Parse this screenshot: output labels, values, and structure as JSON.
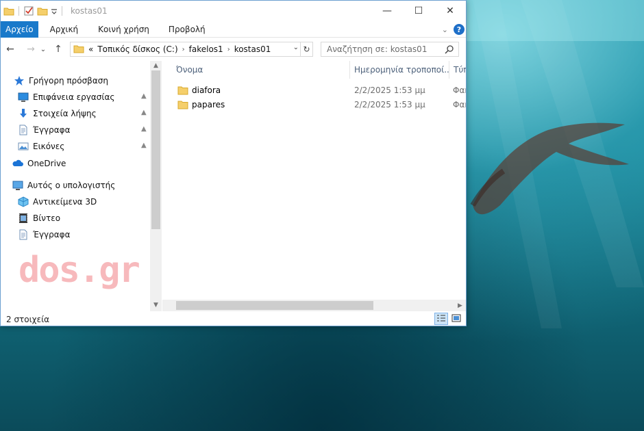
{
  "window": {
    "title": "kostas01",
    "controls": {
      "minimize": "—",
      "maximize": "☐",
      "close": "✕"
    }
  },
  "ribbon": {
    "tabs": [
      "Αρχείο",
      "Αρχική",
      "Κοινή χρήση",
      "Προβολή"
    ],
    "help_label": "?",
    "expand_label": "⌄"
  },
  "navigation": {
    "back": "←",
    "forward": "→",
    "recent": "⌄",
    "up": "↑",
    "overflow": "«",
    "breadcrumbs": [
      "Τοπικός δίσκος (C:)",
      "fakelos1",
      "kostas01"
    ],
    "dropdown": "⌄",
    "refresh": "↻",
    "search_placeholder": "Αναζήτηση σε: kostas01"
  },
  "sidebar": {
    "quick_access": "Γρήγορη πρόσβαση",
    "quick_items": [
      {
        "label": "Επιφάνεια εργασίας",
        "icon": "desktop-icon",
        "pinned": true
      },
      {
        "label": "Στοιχεία λήψης",
        "icon": "downloads-icon",
        "pinned": true
      },
      {
        "label": "Έγγραφα",
        "icon": "documents-icon",
        "pinned": true
      },
      {
        "label": "Εικόνες",
        "icon": "pictures-icon",
        "pinned": true
      }
    ],
    "onedrive": "OneDrive",
    "this_pc": "Αυτός ο υπολογιστής",
    "pc_items": [
      {
        "label": "Αντικείμενα 3D",
        "icon": "3d-objects-icon"
      },
      {
        "label": "Βίντεο",
        "icon": "videos-icon"
      },
      {
        "label": "Έγγραφα",
        "icon": "documents-icon"
      }
    ],
    "pin_glyph": "📌"
  },
  "watermark": "dos.gr",
  "content": {
    "columns": [
      "Όνομα",
      "Ημερομηνία τροποποί...",
      "Τύπ"
    ],
    "sort_glyph": "^",
    "files": [
      {
        "name": "diafora",
        "date": "2/2/2025 1:53 μμ",
        "type": "Φακ"
      },
      {
        "name": "papares",
        "date": "2/2/2025 1:53 μμ",
        "type": "Φακ"
      }
    ]
  },
  "statusbar": {
    "item_count": "2 στοιχεία"
  },
  "colors": {
    "file_tab": "#1979ca",
    "folder_yellow": "#f5cf6b",
    "header_text": "#4c607a",
    "watermark": "#f7b9bc"
  }
}
